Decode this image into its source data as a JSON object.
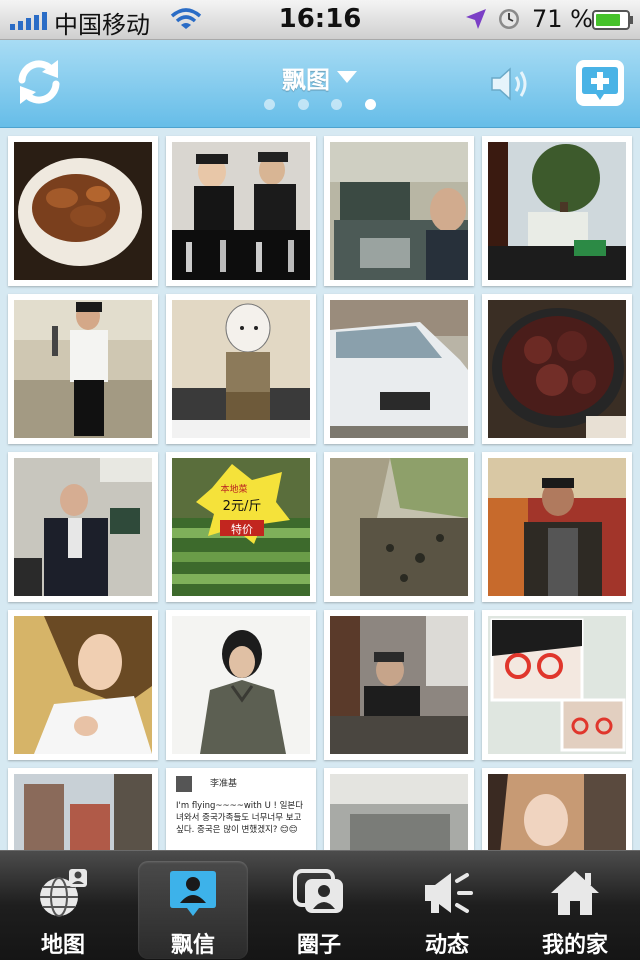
{
  "status_bar": {
    "carrier": "中国移动",
    "time": "16:16",
    "battery": "71 %"
  },
  "header": {
    "title": "飘图",
    "pages": 4,
    "active_page": 4
  },
  "grid": {
    "post_tile": {
      "name": "李准基",
      "text": "I'm flying~~~~with U ! 일본다녀와서 중국가족들도 너무너무 보고 싶다. 중국은 많이 변했겠지? 😊😊"
    },
    "sign_text": [
      "本地菜",
      "2元/斤",
      "特价"
    ]
  },
  "tabs": [
    {
      "label": "地图",
      "icon": "globe-map-icon",
      "active": false
    },
    {
      "label": "飘信",
      "icon": "person-bubble-icon",
      "active": true
    },
    {
      "label": "圈子",
      "icon": "group-circle-icon",
      "active": false
    },
    {
      "label": "动态",
      "icon": "megaphone-icon",
      "active": false
    },
    {
      "label": "我的家",
      "icon": "home-icon",
      "active": false
    }
  ],
  "colors": {
    "header_top": "#a8dcf4",
    "header_bottom": "#66bde8",
    "tab_active_icon": "#3db2ea",
    "battery_fill": "#46c22b"
  }
}
